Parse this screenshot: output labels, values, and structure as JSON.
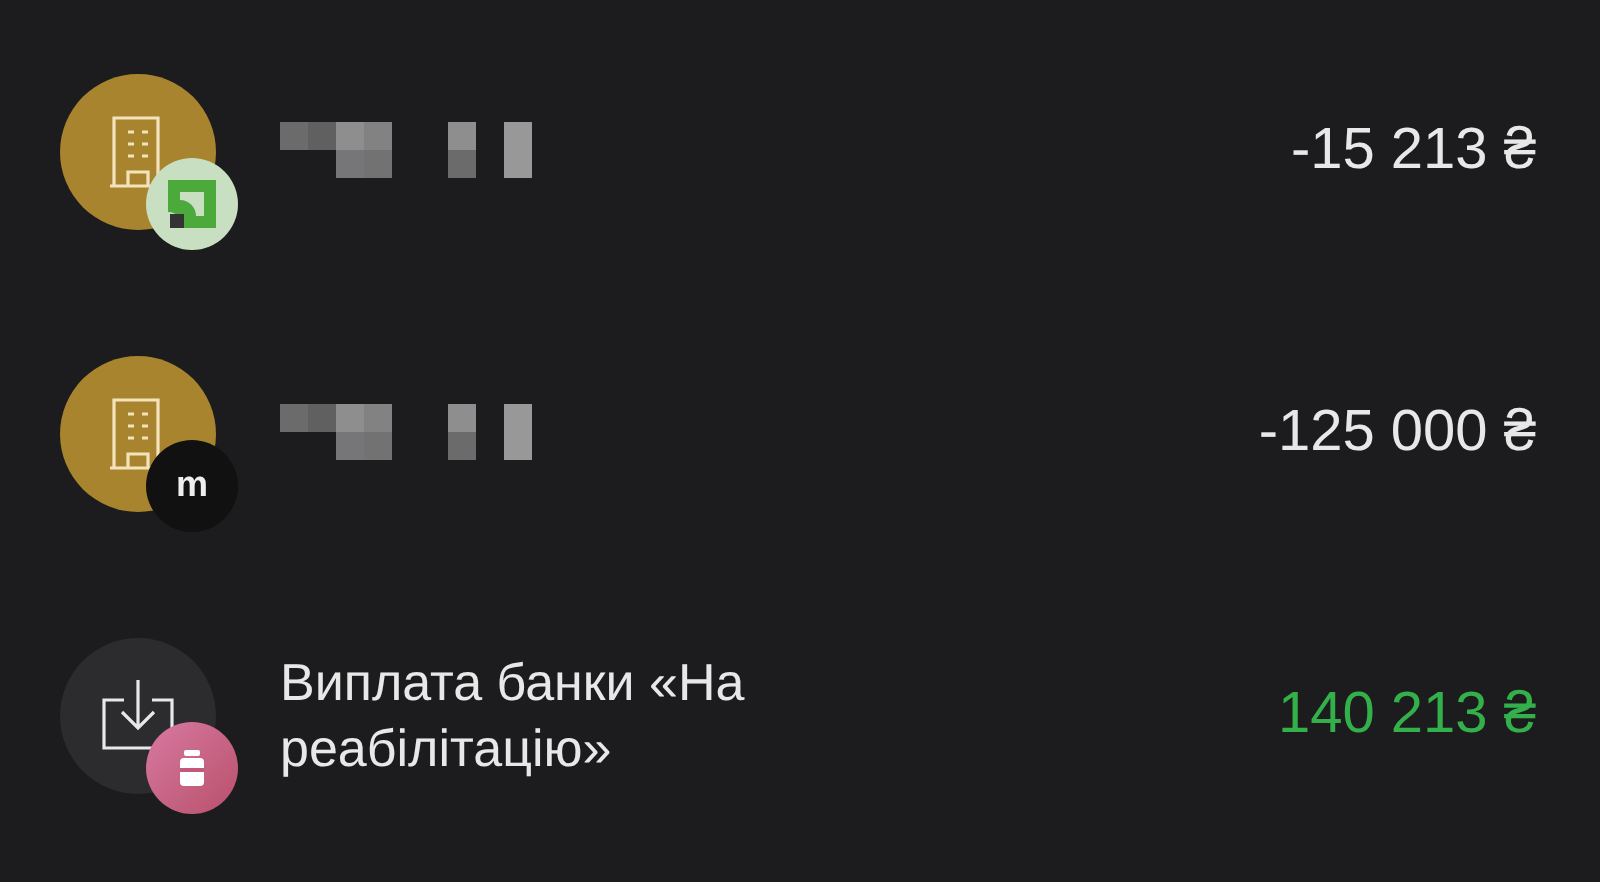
{
  "transactions": [
    {
      "kind": "company",
      "badge": {
        "kind": "bank-logo"
      },
      "amount": "-15 213 ₴",
      "income": false
    },
    {
      "kind": "company",
      "badge": {
        "kind": "letter",
        "text": "m"
      },
      "amount": "-125 000 ₴",
      "income": false
    },
    {
      "kind": "payout",
      "badge": {
        "kind": "jar"
      },
      "name": "Виплата банки «На реабілітацію»",
      "amount": "140 213 ₴",
      "income": true
    }
  ]
}
